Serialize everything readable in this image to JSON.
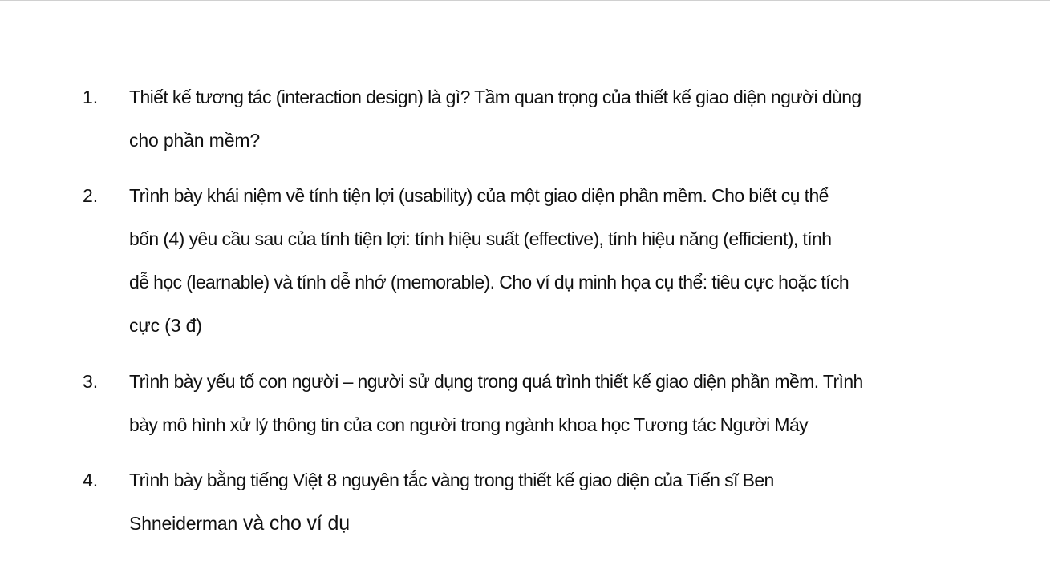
{
  "questions": [
    {
      "number": "1.",
      "lines": [
        "Thiết kế tương tác (interaction design) là gì? Tầm quan trọng của thiết kế giao diện người dùng",
        "cho phần mềm?"
      ]
    },
    {
      "number": "2.",
      "lines": [
        "Trình bày khái niệm về tính tiện lợi (usability) của một giao diện phần mềm. Cho biết cụ thể",
        "bốn (4) yêu cầu sau của tính tiện lợi: tính hiệu suất (effective), tính hiệu năng (efficient), tính",
        "dễ học (learnable) và tính dễ nhớ (memorable). Cho ví dụ minh họa cụ thể: tiêu cực hoặc tích",
        "cực (3 đ)"
      ]
    },
    {
      "number": "3.",
      "lines": [
        "Trình bày yếu tố con người – người sử dụng trong quá trình thiết kế giao diện phần mềm. Trình",
        "bày mô hình xử lý thông tin của con người trong ngành khoa học Tương tác Người Máy"
      ]
    },
    {
      "number": "4.",
      "lines": [
        "Trình bày bằng tiếng Việt 8 nguyên tắc vàng trong thiết kế giao diện của Tiến sĩ Ben",
        "Shneiderman",
        " và cho ví dụ"
      ]
    }
  ]
}
